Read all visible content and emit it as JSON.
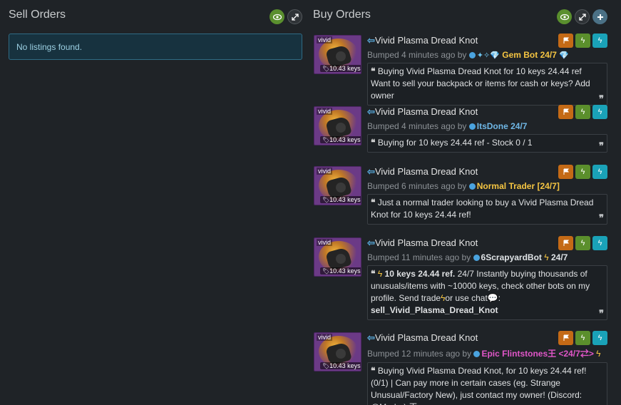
{
  "sell": {
    "title": "Sell Orders",
    "empty_text": "No listings found."
  },
  "buy": {
    "title": "Buy Orders"
  },
  "colors": {
    "accent": "#4aa3df",
    "flag": "#c46a16",
    "bolt": "#5b8f2c",
    "cyan": "#1aa2b8"
  },
  "listings": [
    {
      "quality": "vivid",
      "price": "10.43 keys",
      "title": "Vivid Plasma Dread Knot",
      "bumped": "Bumped 4 minutes ago by",
      "user": "Gem Bot 24/7",
      "message": "Buying Vivid Plasma Dread Knot for 10 keys 24.44 ref Want to sell your backpack or items for cash or keys? Add owner"
    },
    {
      "quality": "vivid",
      "price": "10.43 keys",
      "title": "Vivid Plasma Dread Knot",
      "bumped": "Bumped 4 minutes ago by",
      "user": "ItsDone 24/7",
      "message": "Buying for 10 keys 24.44 ref - Stock 0 / 1"
    },
    {
      "quality": "vivid",
      "price": "10.43 keys",
      "title": "Vivid Plasma Dread Knot",
      "bumped": "Bumped 6 minutes ago by",
      "user": "Normal Trader [24/7]",
      "message": "Just a normal trader looking to buy a Vivid Plasma Dread Knot for 10 keys 24.44 ref!"
    },
    {
      "quality": "vivid",
      "price": "10.43 keys",
      "title": "Vivid Plasma Dread Knot",
      "bumped": "Bumped 11 minutes ago by",
      "user": "6ScrapyardBot",
      "user_suffix": "24/7",
      "message_bold": "10 keys 24.44 ref.",
      "message": "24/7 Instantly buying thousands of unusuals/items with ~10000 keys, check other bots on my profile. Send  trade",
      "message_mid": "or  use  chat",
      "message_end": ":",
      "message_cmd": "sell_Vivid_Plasma_Dread_Knot"
    },
    {
      "quality": "vivid",
      "price": "10.43 keys",
      "title": "Vivid Plasma Dread Knot",
      "bumped": "Bumped 12 minutes ago by",
      "user": "Epic Flintstones王 <24/7⇄>",
      "message": "Buying Vivid Plasma Dread Knot, for 10 keys 24.44 ref! (0/1) | Can pay more in certain cases (eg. Strange Unusual/Factory New), just contact my owner! (Discord: @Moder) 王"
    }
  ]
}
